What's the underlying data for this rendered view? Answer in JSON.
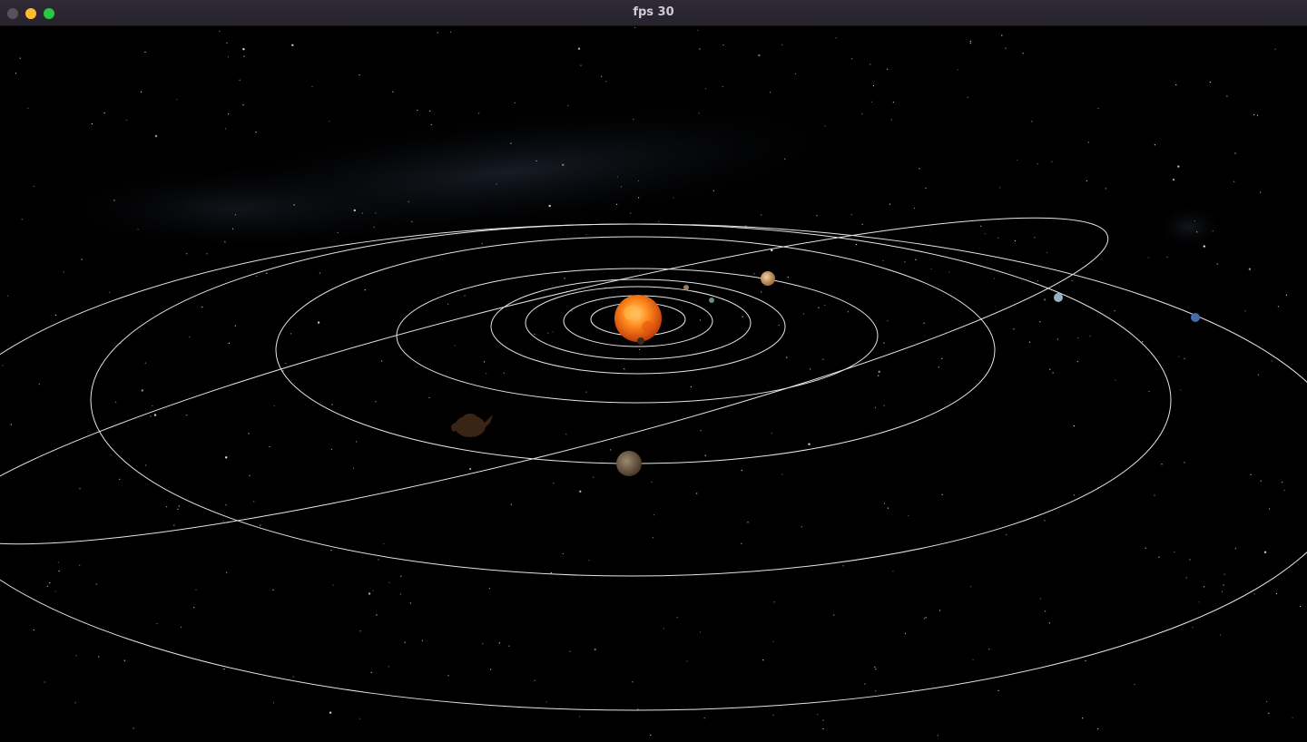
{
  "window": {
    "title": "fps 30"
  },
  "scene": {
    "background": "#000000",
    "orbit_color": "#e8e8e8",
    "sun_color": "#ff8a1c",
    "planets": [
      {
        "name": "mercury-icon",
        "color": "#7a5a3a"
      },
      {
        "name": "venus-icon",
        "color": "#9a7a5a"
      },
      {
        "name": "earth-icon",
        "color": "#6a8a8a"
      },
      {
        "name": "mars-icon",
        "color": "#a0705a"
      },
      {
        "name": "jupiter-icon",
        "color": "#c9a06a"
      },
      {
        "name": "saturn-icon",
        "color": "#7a6a5a"
      },
      {
        "name": "uranus-icon",
        "color": "#9ab0c0"
      },
      {
        "name": "neptune-icon",
        "color": "#4a6ab0"
      },
      {
        "name": "teapot-icon",
        "color": "#4a3020"
      }
    ]
  }
}
